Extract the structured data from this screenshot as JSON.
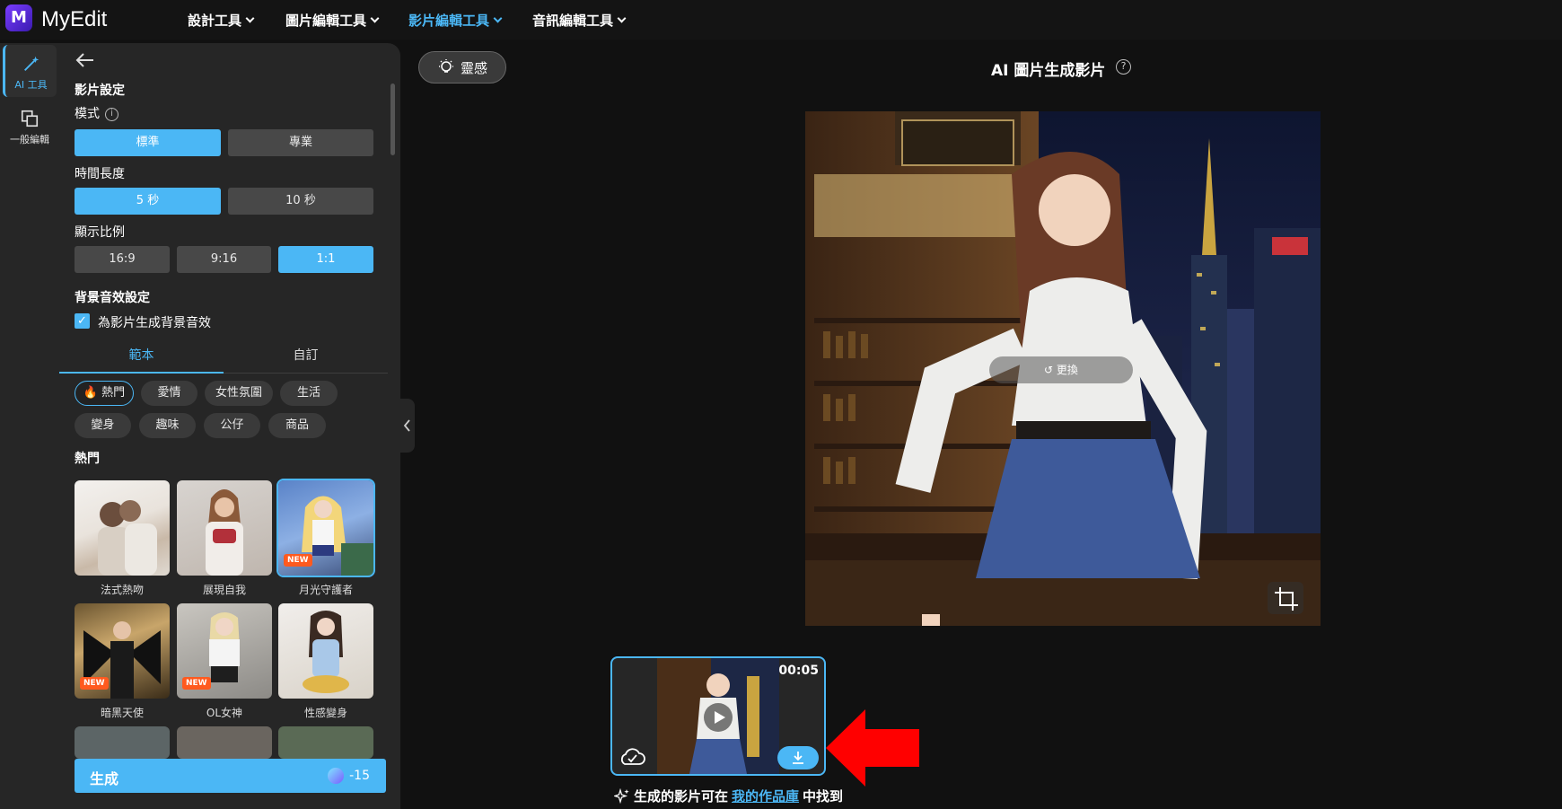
{
  "app": {
    "name": "MyEdit",
    "logo_letter": "M"
  },
  "nav": [
    {
      "label": "設計工具",
      "active": false
    },
    {
      "label": "圖片編輯工具",
      "active": false
    },
    {
      "label": "影片編輯工具",
      "active": true
    },
    {
      "label": "音訊編輯工具",
      "active": false
    }
  ],
  "rail": [
    {
      "label": "AI 工具",
      "active": true
    },
    {
      "label": "一般編輯",
      "active": false
    }
  ],
  "panel": {
    "video_settings": "影片設定",
    "mode_label": "模式",
    "mode_options": [
      "標準",
      "專業"
    ],
    "duration_label": "時間長度",
    "duration_options": [
      "5 秒",
      "10 秒"
    ],
    "ratio_label": "顯示比例",
    "ratio_options": [
      "16:9",
      "9:16",
      "1:1"
    ],
    "bgm_label": "背景音效設定",
    "bgm_checkbox": "為影片生成背景音效",
    "tabs": [
      "範本",
      "自訂"
    ],
    "chips": [
      "🔥 熱門",
      "愛情",
      "女性氛圍",
      "生活",
      "變身",
      "趣味",
      "公仔",
      "商品"
    ],
    "section_title": "熱門",
    "templates": [
      {
        "label": "法式熱吻",
        "is_new": false
      },
      {
        "label": "展現自我",
        "is_new": false
      },
      {
        "label": "月光守護者",
        "is_new": true
      },
      {
        "label": "暗黑天使",
        "is_new": true
      },
      {
        "label": "OL女神",
        "is_new": true
      },
      {
        "label": "性感變身",
        "is_new": false
      }
    ],
    "new_badge": "NEW",
    "generate_label": "生成",
    "generate_cost": "-15"
  },
  "main": {
    "inspire_label": "靈感",
    "title": "AI 圖片生成影片",
    "help_glyph": "?",
    "replace_label": "更換",
    "thumb_duration": "00:05",
    "note_prefix": "生成的影片可在",
    "note_link": "我的作品庫",
    "note_suffix": "中找到"
  },
  "colors": {
    "accent": "#4bb7f5",
    "arrow": "#ff0000",
    "panel": "#262626",
    "bg": "#111111"
  }
}
